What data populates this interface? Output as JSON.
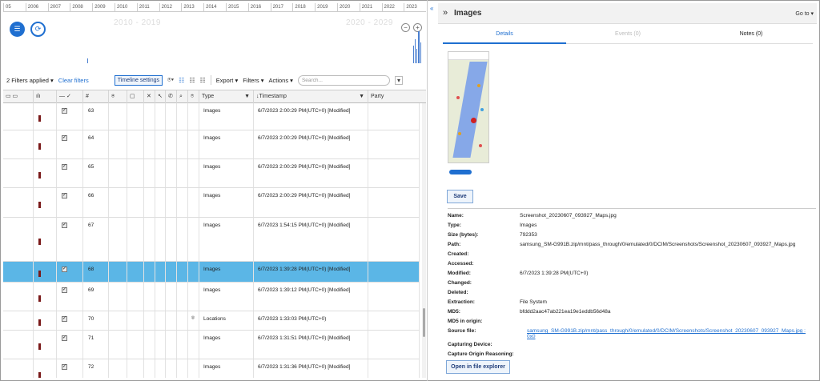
{
  "timeline": {
    "years": [
      "05",
      "2006",
      "2007",
      "2008",
      "2009",
      "2010",
      "2011",
      "2012",
      "2013",
      "2014",
      "2015",
      "2016",
      "2017",
      "2018",
      "2019",
      "2020",
      "2021",
      "2022",
      "2023"
    ],
    "range_left": "2010 - 2019",
    "range_right": "2020 - 2029"
  },
  "toolbar": {
    "filters_applied": "2 Filters applied ▾",
    "clear_filters": "Clear filters",
    "timeline_settings": "Timeline settings",
    "export": "Export ▾",
    "filters": "Filters ▾",
    "actions": "Actions ▾",
    "search_placeholder": "Search..."
  },
  "columns": {
    "number": "#",
    "type": "Type",
    "timestamp": "Timestamp",
    "party": "Party"
  },
  "rows": [
    {
      "num": "63",
      "type": "Images",
      "timestamp": "6/7/2023 2:00:29 PM(UTC+0) [Modified]"
    },
    {
      "num": "64",
      "type": "Images",
      "timestamp": "6/7/2023 2:00:29 PM(UTC+0) [Modified]"
    },
    {
      "num": "65",
      "type": "Images",
      "timestamp": "6/7/2023 2:00:29 PM(UTC+0) [Modified]"
    },
    {
      "num": "66",
      "type": "Images",
      "timestamp": "6/7/2023 2:00:29 PM(UTC+0) [Modified]"
    },
    {
      "num": "67",
      "type": "Images",
      "timestamp": "6/7/2023 1:54:15 PM(UTC+0) [Modified]"
    },
    {
      "num": "68",
      "type": "Images",
      "timestamp": "6/7/2023 1:39:28 PM(UTC+0) [Modified]",
      "selected": true
    },
    {
      "num": "69",
      "type": "Images",
      "timestamp": "6/7/2023 1:39:12 PM(UTC+0) [Modified]"
    },
    {
      "num": "70",
      "type": "Locations",
      "timestamp": "6/7/2023 1:33:03 PM(UTC+0)"
    },
    {
      "num": "71",
      "type": "Images",
      "timestamp": "6/7/2023 1:31:51 PM(UTC+0) [Modified]"
    },
    {
      "num": "72",
      "type": "Images",
      "timestamp": "6/7/2023 1:31:36 PM(UTC+0) [Modified]"
    }
  ],
  "panel": {
    "title": "Images",
    "goto": "Go to ▾",
    "tabs": [
      "Details",
      "Events (0)",
      "Notes (0)"
    ],
    "save": "Save",
    "open_explorer": "Open in file explorer",
    "props": [
      {
        "k": "Name:",
        "v": "Screenshot_20230607_093927_Maps.jpg"
      },
      {
        "k": "Type:",
        "v": "Images"
      },
      {
        "k": "Size (bytes):",
        "v": "792353"
      },
      {
        "k": "Path:",
        "v": "samsung_SM-G991B.zip/mnt/pass_through/0/emulated/0/DCIM/Screenshots/Screenshot_20230607_093927_Maps.jpg"
      },
      {
        "k": "Created:",
        "v": ""
      },
      {
        "k": "Accessed:",
        "v": ""
      },
      {
        "k": "Modified:",
        "v": "6/7/2023 1:39:28 PM(UTC+0)"
      },
      {
        "k": "Changed:",
        "v": ""
      },
      {
        "k": "Deleted:",
        "v": ""
      },
      {
        "k": "Extraction:",
        "v": "   File System"
      },
      {
        "k": "MD5:",
        "v": "bfddd2aac47ab221ea19e1eddb56d48a"
      },
      {
        "k": "MD5 in origin:",
        "v": ""
      },
      {
        "k": "Source file:",
        "v": "samsung_SM-G991B.zip/mnt/pass_through/0/emulated/0/DCIM/Screenshots/Screenshot_20230607_093927_Maps.jpg : 0x0",
        "link": true
      },
      {
        "k": "Capturing Device:",
        "v": ""
      },
      {
        "k": "Capture Origin Reasoning:",
        "v": ""
      }
    ]
  }
}
